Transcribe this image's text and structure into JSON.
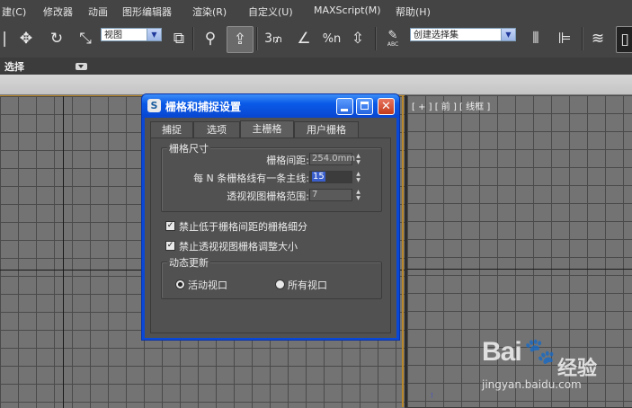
{
  "menu": {
    "items": [
      "建(C)",
      "修改器",
      "动画",
      "图形编辑器",
      "渲染(R)",
      "自定义(U)",
      "MAXScript(M)",
      "帮助(H)"
    ]
  },
  "toolbar": {
    "view_dropdown": "视图",
    "selection_set_dropdown": "创建选择集",
    "snap_3": "3",
    "percent_snap": "%n",
    "abc_label": "ABC"
  },
  "ribbon": {
    "label": "选择"
  },
  "viewport_right": {
    "label": "[ + ] [ 前 ] [ 线框 ]"
  },
  "dialog": {
    "title": "栅格和捕捉设置",
    "tabs": [
      "捕捉",
      "选项",
      "主栅格",
      "用户栅格"
    ],
    "active_tab": "主栅格",
    "grid_dims_group": "栅格尺寸",
    "grid_spacing_label": "栅格间距:",
    "grid_spacing_value": "254.0mm",
    "major_lines_label": "每 N 条栅格线有一条主线:",
    "major_lines_value": "15",
    "persp_extent_label": "透视视图栅格范围:",
    "persp_extent_value": "7",
    "check_inhibit_sub": "禁止低于栅格间距的栅格细分",
    "check_inhibit_persp": "禁止透视视图栅格调整大小",
    "dynamic_update_group": "动态更新",
    "radio_active": "活动视口",
    "radio_all": "所有视口"
  },
  "watermark": {
    "brand": "Bai",
    "brand_suffix": "经验",
    "url": "jingyan.baidu.com"
  }
}
